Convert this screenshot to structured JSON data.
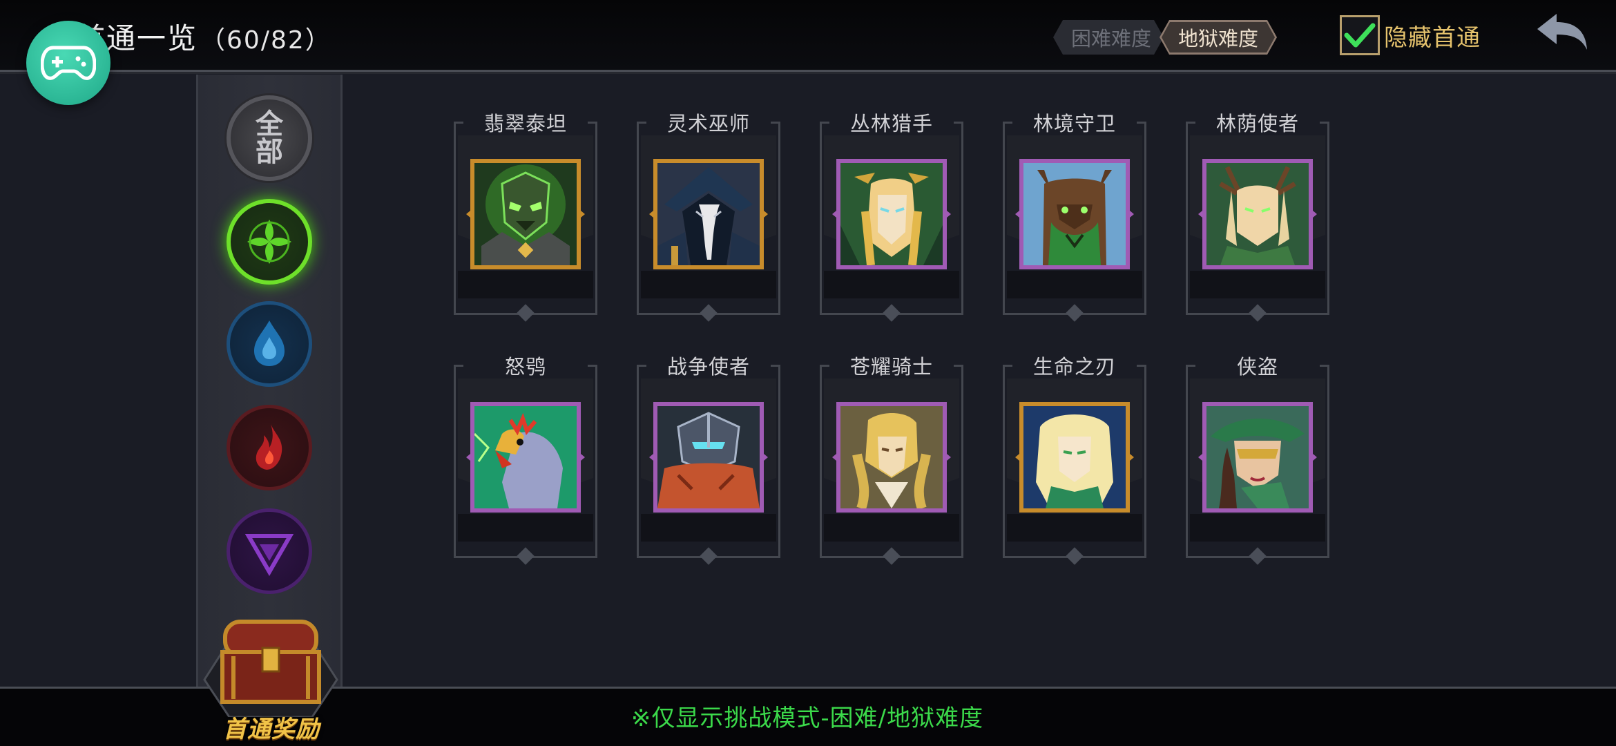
{
  "header": {
    "title": "首通一览",
    "count": "（60/82）",
    "difficulty_tabs": [
      {
        "label": "困难难度",
        "active": false
      },
      {
        "label": "地狱难度",
        "active": true
      }
    ],
    "hide_cleared": {
      "label": "隐藏首通",
      "checked": true
    }
  },
  "sidebar": {
    "factions": [
      {
        "name": "all",
        "label": "全部",
        "selected": false
      },
      {
        "name": "nature",
        "selected": true
      },
      {
        "name": "water",
        "selected": false
      },
      {
        "name": "fire",
        "selected": false
      },
      {
        "name": "arcane",
        "selected": false
      }
    ],
    "reward_label": "首通奖励"
  },
  "heroes": [
    {
      "name": "翡翠泰坦",
      "frame": "gold"
    },
    {
      "name": "灵术巫师",
      "frame": "gold"
    },
    {
      "name": "丛林猎手",
      "frame": "purple"
    },
    {
      "name": "林境守卫",
      "frame": "purple"
    },
    {
      "name": "林荫使者",
      "frame": "purple"
    },
    {
      "name": "怒鸮",
      "frame": "purple"
    },
    {
      "name": "战争使者",
      "frame": "purple"
    },
    {
      "name": "苍耀骑士",
      "frame": "purple"
    },
    {
      "name": "生命之刃",
      "frame": "gold"
    },
    {
      "name": "侠盗",
      "frame": "purple"
    }
  ],
  "footer": {
    "note": "※仅显示挑战模式-困难/地狱难度"
  },
  "colors": {
    "accent_green": "#3bd94a",
    "gold_frame": "#c88c2b",
    "purple_frame": "#a05bb4",
    "label_gold": "#e6c36d"
  }
}
